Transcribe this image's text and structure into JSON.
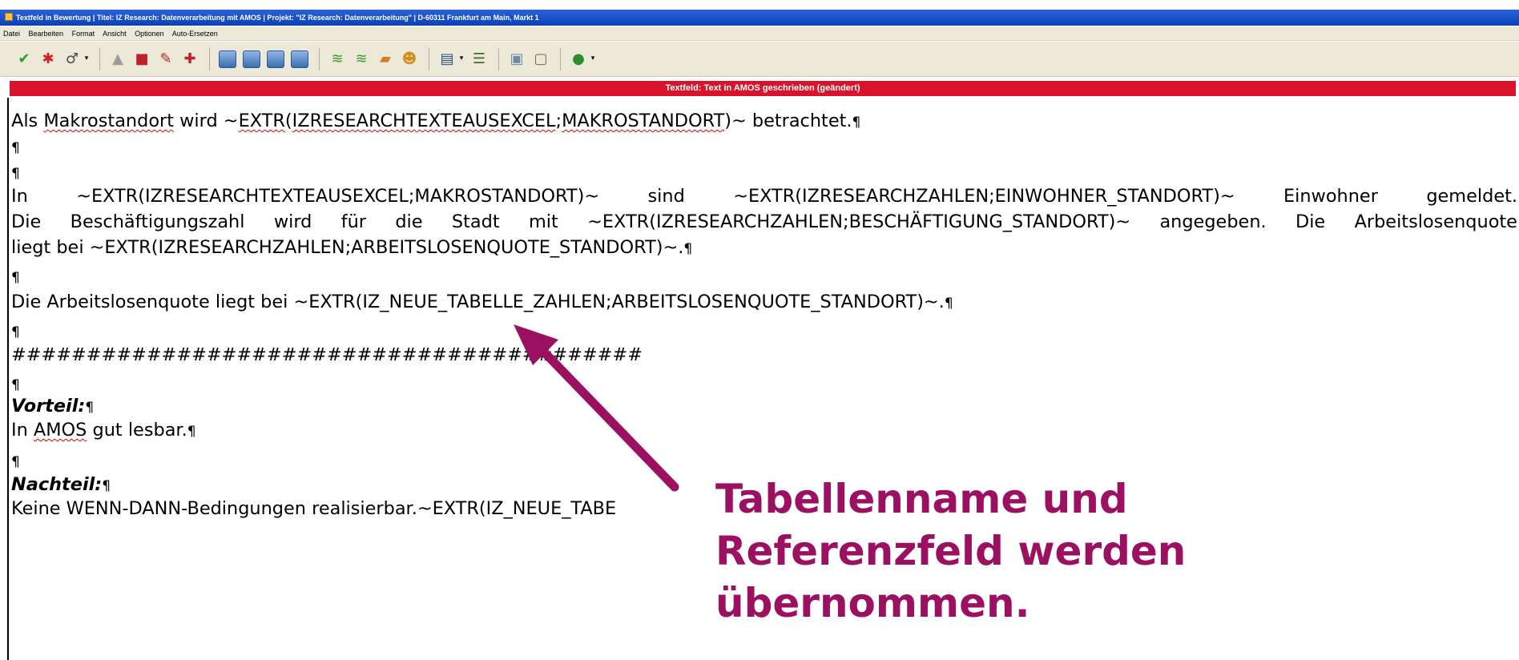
{
  "window": {
    "title": "Textfeld in Bewertung | Titel: IZ Research: Datenverarbeitung mit AMOS | Projekt: \"IZ Research: Datenverarbeitung\" | D-60311 Frankfurt am Main, Markt 1"
  },
  "menu": {
    "items": [
      {
        "label": "Datei"
      },
      {
        "label": "Bearbeiten"
      },
      {
        "label": "Format"
      },
      {
        "label": "Ansicht"
      },
      {
        "label": "Optionen"
      },
      {
        "label": "Auto-Ersetzen"
      }
    ]
  },
  "toolbar": {
    "buttons": [
      "check-icon",
      "cancel-icon",
      "edit-icon",
      "spell-icon",
      "book-icon",
      "pen-icon",
      "format-icon",
      "view1-icon",
      "view2-icon",
      "view3-icon",
      "view4-icon",
      "stack1-icon",
      "stack2-icon",
      "stack3-icon",
      "person-icon",
      "table-icon",
      "list-icon",
      "doc-icon",
      "paste-icon",
      "help-icon"
    ]
  },
  "status": {
    "text": "Textfeld: Text in AMOS geschrieben (geändert)",
    "color": "#d9132a"
  },
  "document": {
    "l1_a": "Als ",
    "l1_b": "Makrostandort",
    "l1_c": " wird ~",
    "l1_d": "EXTR",
    "l1_e": "(",
    "l1_f": "IZRESEARCHTEXTEAUSEXCEL",
    "l1_g": ";",
    "l1_h": "MAKROSTANDORT",
    "l1_i": ")~ betrachtet.",
    "pilcrow": "¶",
    "l4": [
      "In",
      "~EXTR(IZRESEARCHTEXTEAUSEXCEL;MAKROSTANDORT)~",
      "sind",
      "~EXTR(IZRESEARCHZAHLEN;EINWOHNER_STANDORT)~",
      "Einwohner",
      "gemeldet."
    ],
    "l5": [
      "Die",
      "Beschäftigungszahl",
      "wird",
      "für",
      "die",
      "Stadt",
      "mit",
      "~EXTR(IZRESEARCHZAHLEN;BESCHÄFTIGUNG_STANDORT)~",
      "angegeben.",
      "Die",
      "Arbeitslosenquote"
    ],
    "l6": "liegt bei ~EXTR(IZRESEARCHZAHLEN;ARBEITSLOSENQUOTE_STANDORT)~.",
    "l8": "Die Arbeitslosenquote liegt bei ~EXTR(IZ_NEUE_TABELLE_ZAHLEN;ARBEITSLOSENQUOTE_STANDORT)~.",
    "hashes": "##########################################",
    "vorteil_label": "Vorteil:",
    "vorteil_a": "In ",
    "vorteil_b": "AMOS",
    "vorteil_c": " gut lesbar.",
    "nachteil_label": "Nachteil:",
    "nachteil_text": "Keine WENN-DANN-Bedingungen realisierbar.~EXTR(IZ_NEUE_TABE"
  },
  "callout": {
    "line1": "Tabellenname und",
    "line2": "Referenzfeld werden",
    "line3": "übernommen.",
    "color": "#9b1060"
  }
}
